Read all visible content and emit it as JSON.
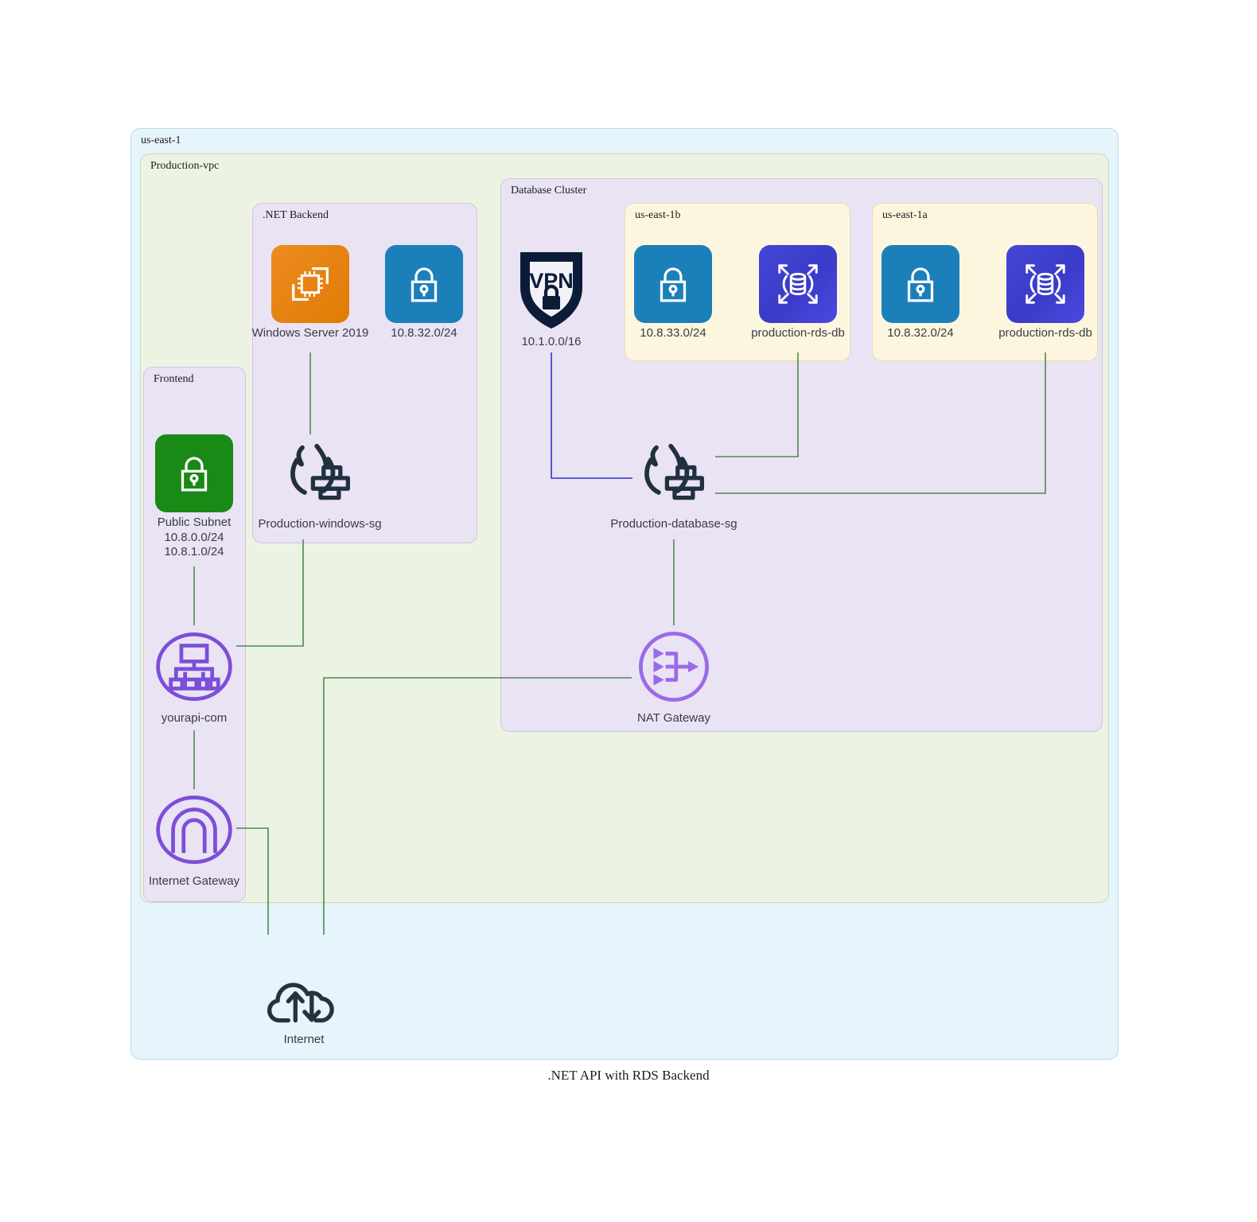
{
  "figure": {
    "caption": ".NET API with RDS Backend"
  },
  "clusters": {
    "region": {
      "label": "us-east-1",
      "color": "#e6f4fb"
    },
    "vpc": {
      "label": "Production-vpc",
      "color": "#ecf3e3"
    },
    "backend": {
      "label": ".NET Backend",
      "color": "#e9e3f4"
    },
    "frontend": {
      "label": "Frontend",
      "color": "#e9e3f4"
    },
    "dbcluster": {
      "label": "Database Cluster",
      "color": "#e9e3f4"
    },
    "az_b": {
      "label": "us-east-1b",
      "color": "#fdf6df"
    },
    "az_a": {
      "label": "us-east-1a",
      "color": "#fdf6df"
    }
  },
  "nodes": {
    "windows_server": {
      "label": "Windows Server 2019",
      "icon": "ec2-instance-icon",
      "color": "#e07b05"
    },
    "backend_subnet": {
      "label": "10.8.32.0/24",
      "icon": "subnet-lock-icon",
      "color": "#1b7fba"
    },
    "windows_sg": {
      "label": "Production-windows-sg",
      "icon": "firewall-icon",
      "color": "#21303f"
    },
    "public_subnet": {
      "label": "Public Subnet\n10.8.0.0/24\n10.8.1.0/24",
      "icon": "public-subnet-lock-icon",
      "color": "#1a8a17"
    },
    "route53": {
      "label": "yourapi-com",
      "icon": "dns-hierarchy-icon",
      "color": "#7d4ed8"
    },
    "internet_gateway": {
      "label": "Internet Gateway",
      "icon": "internet-gateway-arch-icon",
      "color": "#7d4ed8"
    },
    "vpn": {
      "label": "10.1.0.0/16",
      "icon": "vpn-shield-lock-icon",
      "color": "#0b1c38"
    },
    "az_b_subnet": {
      "label": "10.8.33.0/24",
      "icon": "subnet-lock-icon",
      "color": "#1b7fba"
    },
    "az_b_rds": {
      "label": "production-rds-db",
      "icon": "rds-database-icon",
      "color": "#3b3bc9"
    },
    "az_a_subnet": {
      "label": "10.8.32.0/24",
      "icon": "subnet-lock-icon",
      "color": "#1b7fba"
    },
    "az_a_rds": {
      "label": "production-rds-db",
      "icon": "rds-database-icon",
      "color": "#3b3bc9"
    },
    "database_sg": {
      "label": "Production-database-sg",
      "icon": "firewall-icon",
      "color": "#21303f"
    },
    "nat_gateway": {
      "label": "NAT Gateway",
      "icon": "nat-gateway-icon",
      "color": "#9a6ae8"
    },
    "internet": {
      "label": "Internet",
      "icon": "internet-cloud-icon",
      "color": "#25323f"
    }
  },
  "edges": [
    {
      "from": "windows_server",
      "to": "windows_sg",
      "color": "#4f8a4f"
    },
    {
      "from": "public_subnet",
      "to": "route53",
      "color": "#4f8a4f"
    },
    {
      "from": "route53",
      "to": "windows_sg",
      "color": "#4f8a4f"
    },
    {
      "from": "route53",
      "to": "internet_gateway",
      "color": "#4f8a4f"
    },
    {
      "from": "vpn",
      "to": "database_sg",
      "color": "#3333cc"
    },
    {
      "from": "az_b_rds",
      "to": "database_sg",
      "color": "#4f8a4f"
    },
    {
      "from": "az_a_rds",
      "to": "database_sg",
      "color": "#4f8a4f"
    },
    {
      "from": "database_sg",
      "to": "nat_gateway",
      "color": "#4f8a4f"
    },
    {
      "from": "nat_gateway",
      "to": "internet",
      "color": "#4f8a4f"
    },
    {
      "from": "internet_gateway",
      "to": "internet",
      "color": "#4f8a4f"
    }
  ]
}
